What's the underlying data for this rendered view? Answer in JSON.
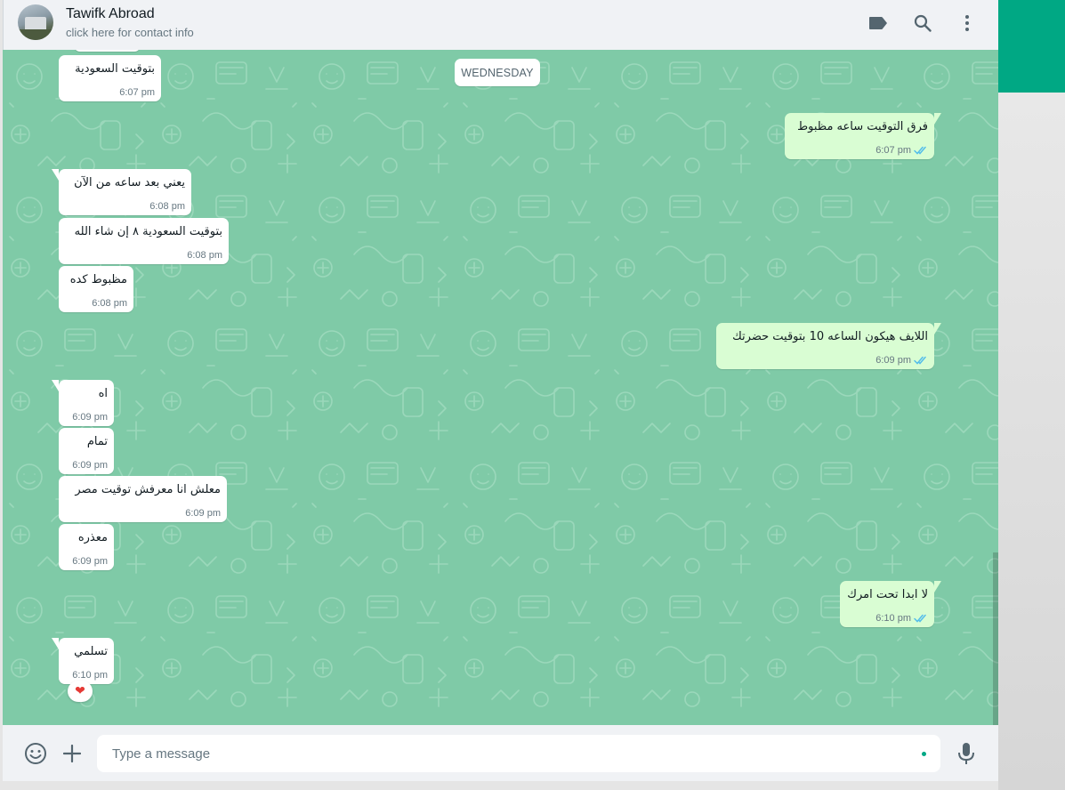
{
  "header": {
    "contact_name": "Tawifk Abroad",
    "contact_subtitle": "click here for contact info",
    "icons": [
      "label-icon",
      "search-icon",
      "menu-icon"
    ]
  },
  "date_separator": "WEDNESDAY",
  "messages": [
    {
      "direction": "in",
      "text": "بتوقيت السعودية",
      "time": "6:07 pm"
    },
    {
      "direction": "out",
      "text": "فرق التوقيت ساعه مظبوط",
      "time": "6:07 pm",
      "status": "read"
    },
    {
      "direction": "in",
      "text": "يعني بعد ساعه من الآن",
      "time": "6:08 pm"
    },
    {
      "direction": "in",
      "text": "بتوقيت السعودية ٨ إن شاء الله",
      "time": "6:08 pm"
    },
    {
      "direction": "in",
      "text": "مظبوط كده",
      "time": "6:08 pm"
    },
    {
      "direction": "out",
      "text": "اللايف هيكون الساعه 10 بتوقيت حضرتك",
      "time": "6:09 pm",
      "status": "read"
    },
    {
      "direction": "in",
      "text": "اه",
      "time": "6:09 pm"
    },
    {
      "direction": "in",
      "text": "تمام",
      "time": "6:09 pm"
    },
    {
      "direction": "in",
      "text": "معلش انا معرفش توقيت مصر",
      "time": "6:09 pm"
    },
    {
      "direction": "in",
      "text": "معذره",
      "time": "6:09 pm"
    },
    {
      "direction": "out",
      "text": "لا ابدا تحت امرك",
      "time": "6:10 pm",
      "status": "read"
    },
    {
      "direction": "in",
      "text": "تسلمي",
      "time": "6:10 pm",
      "reaction": "❤"
    }
  ],
  "composer": {
    "placeholder": "Type a message",
    "icons": [
      "emoji-icon",
      "attach-plus-icon",
      "microphone-icon"
    ]
  },
  "colors": {
    "wallpaper": "#7fcaa7",
    "incoming": "#ffffff",
    "outgoing": "#d9fdd3",
    "accent": "#00a884",
    "read_ticks": "#53bdeb"
  }
}
